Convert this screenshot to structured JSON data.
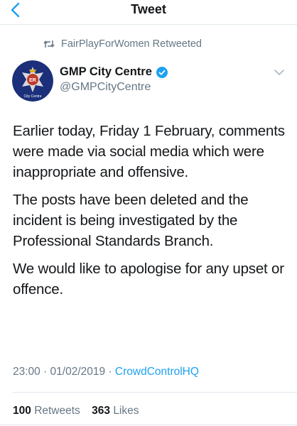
{
  "header": {
    "title": "Tweet",
    "back_icon": "chevron-left-icon"
  },
  "retweet_context": {
    "text": "FairPlayForWomen Retweeted",
    "icon": "retweet-icon"
  },
  "author": {
    "display_name": "GMP City Centre",
    "handle": "@GMPCityCentre",
    "verified": true,
    "avatar_caption": "City Centre",
    "avatar_badge_letters": "ER"
  },
  "tweet": {
    "paragraphs": [
      "Earlier today, Friday 1 February, comments were made via social media which were inappropriate and offensive.",
      "The posts have been deleted and the incident is being investigated by the Professional Standards Branch.",
      "We would like to apologise for any upset or offence."
    ],
    "timestamp": "23:00 · 01/02/2019 · ",
    "source": "CrowdControlHQ"
  },
  "stats": {
    "retweets_count": "100",
    "retweets_label": "Retweets",
    "likes_count": "363",
    "likes_label": "Likes"
  },
  "colors": {
    "accent": "#1da1f2",
    "secondary_text": "#657786",
    "avatar_bg": "#1b2f7a"
  }
}
